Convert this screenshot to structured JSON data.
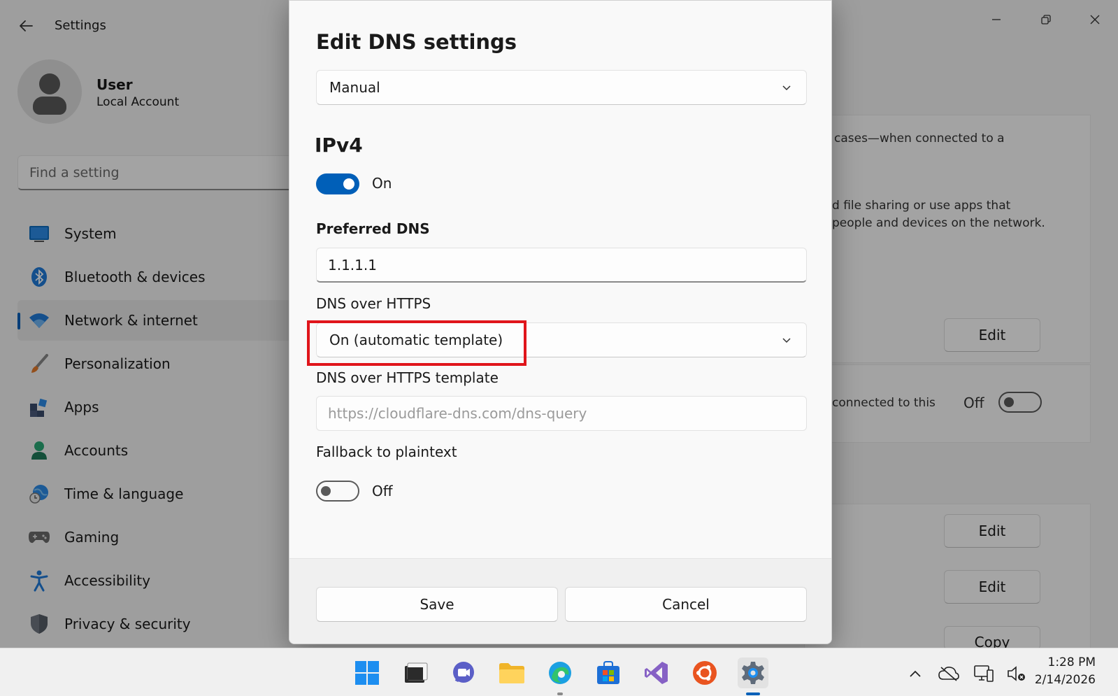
{
  "app": {
    "title": "Settings",
    "user": {
      "name": "User",
      "account_type": "Local Account"
    },
    "search_placeholder": "Find a setting",
    "nav": [
      {
        "label": "System",
        "icon": "monitor-icon"
      },
      {
        "label": "Bluetooth & devices",
        "icon": "bluetooth-icon"
      },
      {
        "label": "Network & internet",
        "icon": "wifi-icon",
        "active": true
      },
      {
        "label": "Personalization",
        "icon": "brush-icon"
      },
      {
        "label": "Apps",
        "icon": "apps-icon"
      },
      {
        "label": "Accounts",
        "icon": "person-icon"
      },
      {
        "label": "Time & language",
        "icon": "globe-clock-icon"
      },
      {
        "label": "Gaming",
        "icon": "gamepad-icon"
      },
      {
        "label": "Accessibility",
        "icon": "accessibility-icon"
      },
      {
        "label": "Privacy & security",
        "icon": "shield-icon"
      }
    ],
    "content": {
      "text1": "cases—when connected to a",
      "text2": "d file sharing or use apps that",
      "text3": "people and devices on the network.",
      "text4": "connected to this",
      "toggle_off_label": "Off",
      "edit_label": "Edit",
      "copy_label": "Copy"
    }
  },
  "dialog": {
    "title": "Edit DNS settings",
    "mode_select": "Manual",
    "section": "IPv4",
    "ipv4_toggle_label": "On",
    "preferred_dns_label": "Preferred DNS",
    "preferred_dns_value": "1.1.1.1",
    "doh_label": "DNS over HTTPS",
    "doh_select": "On (automatic template)",
    "doh_template_label": "DNS over HTTPS template",
    "doh_template_placeholder": "https://cloudflare-dns.com/dns-query",
    "fallback_label": "Fallback to plaintext",
    "fallback_toggle_label": "Off",
    "save_label": "Save",
    "cancel_label": "Cancel"
  },
  "taskbar": {
    "apps": [
      "windows-start-icon",
      "terminal-icon",
      "teams-chat-icon",
      "file-explorer-icon",
      "edge-icon",
      "store-icon",
      "visual-studio-icon",
      "ubuntu-icon",
      "settings-icon"
    ],
    "time": "1:28 PM",
    "date": "2/14/2026"
  },
  "colors": {
    "accent": "#005fb8",
    "highlight": "#e0151b"
  }
}
